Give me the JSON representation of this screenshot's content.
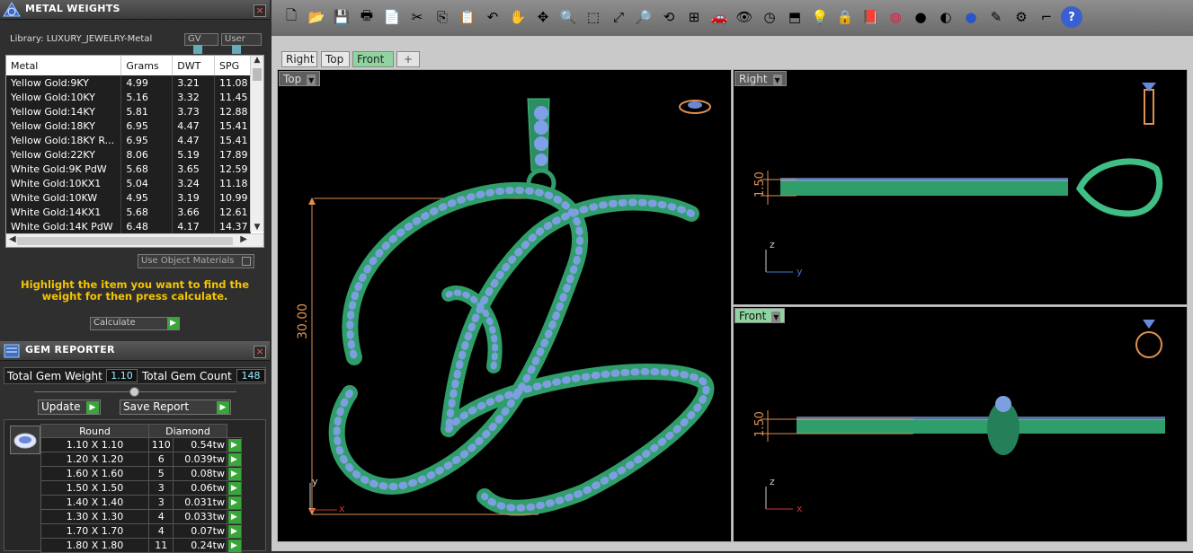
{
  "metal_panel": {
    "title": "METAL WEIGHTS",
    "library_label": "Library: LUXURY_JEWELRY-Metal",
    "gv_label": "GV",
    "user_label": "User",
    "columns": [
      "Metal",
      "Grams",
      "DWT",
      "SPG"
    ],
    "rows": [
      [
        "Yellow Gold:9KY",
        "4.99",
        "3.21",
        "11.08"
      ],
      [
        "Yellow Gold:10KY",
        "5.16",
        "3.32",
        "11.45"
      ],
      [
        "Yellow Gold:14KY",
        "5.81",
        "3.73",
        "12.88"
      ],
      [
        "Yellow Gold:18KY",
        "6.95",
        "4.47",
        "15.41"
      ],
      [
        "Yellow Gold:18KY R...",
        "6.95",
        "4.47",
        "15.41"
      ],
      [
        "Yellow Gold:22KY",
        "8.06",
        "5.19",
        "17.89"
      ],
      [
        "White Gold:9K PdW",
        "5.68",
        "3.65",
        "12.59"
      ],
      [
        "White Gold:10KX1",
        "5.04",
        "3.24",
        "11.18"
      ],
      [
        "White Gold:10KW",
        "4.95",
        "3.19",
        "10.99"
      ],
      [
        "White Gold:14KX1",
        "5.68",
        "3.66",
        "12.61"
      ],
      [
        "White Gold:14K PdW",
        "6.48",
        "4.17",
        "14.37"
      ]
    ],
    "use_object_materials": "Use Object Materials",
    "instruction": "Highlight the item you want to find the weight for then press calculate.",
    "calculate_label": "Calculate"
  },
  "gem_panel": {
    "title": "GEM REPORTER",
    "total_weight_label": "Total Gem Weight",
    "total_weight_value": "1.10",
    "total_count_label": "Total Gem Count",
    "total_count_value": "148",
    "update_label": "Update",
    "save_report_label": "Save Report",
    "shape_header": "Round",
    "material_header": "Diamond",
    "rows": [
      [
        "1.10 X 1.10",
        "110",
        "0.54tw"
      ],
      [
        "1.20 X 1.20",
        "6",
        "0.039tw"
      ],
      [
        "1.60 X 1.60",
        "5",
        "0.08tw"
      ],
      [
        "1.50 X 1.50",
        "3",
        "0.06tw"
      ],
      [
        "1.40 X 1.40",
        "3",
        "0.031tw"
      ],
      [
        "1.30 X 1.30",
        "4",
        "0.033tw"
      ],
      [
        "1.70 X 1.70",
        "4",
        "0.07tw"
      ],
      [
        "1.80 X 1.80",
        "11",
        "0.24tw"
      ]
    ]
  },
  "toolbar": {
    "icons": [
      "new-file-icon",
      "open-folder-icon",
      "save-icon",
      "print-icon",
      "copy-doc-icon",
      "cut-icon",
      "copy-icon",
      "paste-icon",
      "undo-icon",
      "pan-hand-icon",
      "move-icon",
      "zoom-icon",
      "zoom-window-icon",
      "zoom-extents-icon",
      "zoom-selected-icon",
      "rotate-view-icon",
      "four-viewports-icon",
      "car-icon",
      "hide-icon",
      "clock-icon",
      "snap-icon",
      "lightbulb-icon",
      "lock-icon",
      "layer-icon",
      "color-wheel-icon",
      "shade-sphere-icon",
      "render-sphere-icon",
      "blue-sphere-icon",
      "paint-icon",
      "settings-gear-icon",
      "dimension-icon",
      "help-icon"
    ]
  },
  "tabs": [
    "Right",
    "Top",
    "Front"
  ],
  "tab_add": "+",
  "viewports": {
    "top": {
      "label": "Top",
      "dimension": "30.00",
      "axis_x": "x",
      "axis_y": "y"
    },
    "right": {
      "label": "Right",
      "dimension": "1.50",
      "axis_z": "z",
      "axis_y": "y"
    },
    "front": {
      "label": "Front",
      "dimension": "1.50",
      "axis_z": "z",
      "axis_x": "x"
    }
  },
  "colors": {
    "accent_green": "#3aa53a",
    "instruction_yellow": "#f5c400",
    "metal_green": "#2f9e6b",
    "gem_blue": "#7d9fe0",
    "dimension_orange": "#e09050"
  }
}
